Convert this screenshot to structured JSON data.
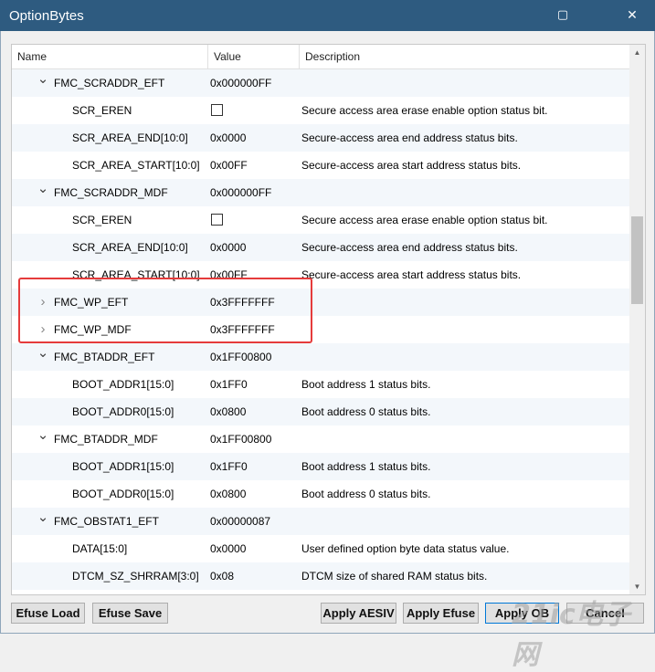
{
  "window": {
    "title": "OptionBytes",
    "close_glyph": "✕",
    "restore_glyph": "▢"
  },
  "table": {
    "headers": {
      "name": "Name",
      "value": "Value",
      "description": "Description"
    },
    "rows": [
      {
        "level": 0,
        "expanded": true,
        "name": "FMC_SCRADDR_EFT",
        "value": "0x000000FF",
        "desc": "",
        "check": false
      },
      {
        "level": 1,
        "name": "SCR_EREN",
        "value": "",
        "desc": "Secure access area erase enable option status bit.",
        "check": true
      },
      {
        "level": 1,
        "name": "SCR_AREA_END[10:0]",
        "value": "0x0000",
        "desc": "Secure-access area end address status bits.",
        "check": false
      },
      {
        "level": 1,
        "name": "SCR_AREA_START[10:0]",
        "value": "0x00FF",
        "desc": "Secure-access area start address status bits.",
        "check": false
      },
      {
        "level": 0,
        "expanded": true,
        "name": "FMC_SCRADDR_MDF",
        "value": "0x000000FF",
        "desc": "",
        "check": false
      },
      {
        "level": 1,
        "name": "SCR_EREN",
        "value": "",
        "desc": "Secure access area erase enable option status bit.",
        "check": true
      },
      {
        "level": 1,
        "name": "SCR_AREA_END[10:0]",
        "value": "0x0000",
        "desc": "Secure-access area end address status bits.",
        "check": false
      },
      {
        "level": 1,
        "name": "SCR_AREA_START[10:0]",
        "value": "0x00FF",
        "desc": "Secure-access area start address status bits.",
        "check": false
      },
      {
        "level": 0,
        "expanded": false,
        "name": "FMC_WP_EFT",
        "value": "0x3FFFFFFF",
        "desc": "",
        "check": false
      },
      {
        "level": 0,
        "expanded": false,
        "name": "FMC_WP_MDF",
        "value": "0x3FFFFFFF",
        "desc": "",
        "check": false
      },
      {
        "level": 0,
        "expanded": true,
        "name": "FMC_BTADDR_EFT",
        "value": "0x1FF00800",
        "desc": "",
        "check": false
      },
      {
        "level": 1,
        "name": "BOOT_ADDR1[15:0]",
        "value": "0x1FF0",
        "desc": "Boot address 1 status bits.",
        "check": false
      },
      {
        "level": 1,
        "name": "BOOT_ADDR0[15:0]",
        "value": "0x0800",
        "desc": "Boot address 0 status bits.",
        "check": false
      },
      {
        "level": 0,
        "expanded": true,
        "name": "FMC_BTADDR_MDF",
        "value": "0x1FF00800",
        "desc": "",
        "check": false
      },
      {
        "level": 1,
        "name": "BOOT_ADDR1[15:0]",
        "value": "0x1FF0",
        "desc": "Boot address 1 status bits.",
        "check": false
      },
      {
        "level": 1,
        "name": "BOOT_ADDR0[15:0]",
        "value": "0x0800",
        "desc": "Boot address 0 status bits.",
        "check": false
      },
      {
        "level": 0,
        "expanded": true,
        "name": "FMC_OBSTAT1_EFT",
        "value": "0x00000087",
        "desc": "",
        "check": false
      },
      {
        "level": 1,
        "name": "DATA[15:0]",
        "value": "0x0000",
        "desc": "User defined option byte data status value.",
        "check": false
      },
      {
        "level": 1,
        "name": "DTCM_SZ_SHRRAM[3:0]",
        "value": "0x08",
        "desc": "DTCM size of shared RAM status bits.",
        "check": false
      }
    ]
  },
  "buttons": {
    "efuse_load": "Efuse Load",
    "efuse_save": "Efuse Save",
    "apply_aesiv": "Apply AESIV",
    "apply_efuse": "Apply Efuse",
    "apply_ob": "Apply OB",
    "cancel": "Cancel"
  },
  "watermark": "21ic电子网",
  "colors": {
    "titlebar": "#2e5b80",
    "highlight": "#e53b3b",
    "row_alt": "#f3f7fb"
  }
}
